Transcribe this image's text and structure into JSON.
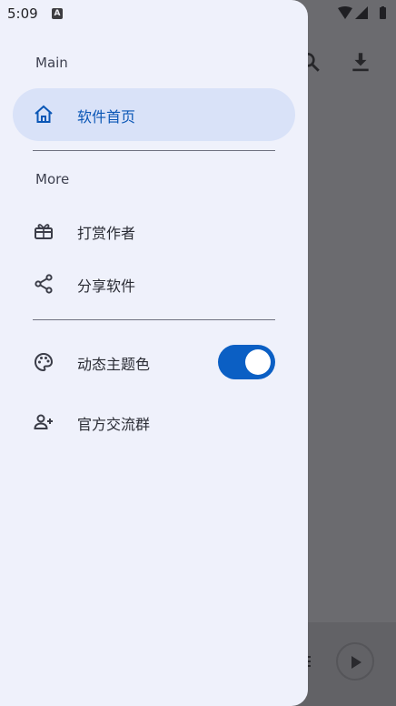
{
  "status_bar": {
    "time": "5:09",
    "a_icon": "A"
  },
  "drawer": {
    "section_main": "Main",
    "section_more": "More",
    "items": [
      {
        "label": "软件首页",
        "icon": "home-icon",
        "active": true
      },
      {
        "label": "打赏作者",
        "icon": "gift-icon"
      },
      {
        "label": "分享软件",
        "icon": "share-icon"
      },
      {
        "label": "动态主题色",
        "icon": "palette-icon",
        "toggle_on": true
      },
      {
        "label": "官方交流群",
        "icon": "group-add-icon"
      }
    ]
  },
  "colors": {
    "accent": "#0b5fc4",
    "active_bg": "#d9e2f8",
    "drawer_bg": "#eff1fb"
  }
}
